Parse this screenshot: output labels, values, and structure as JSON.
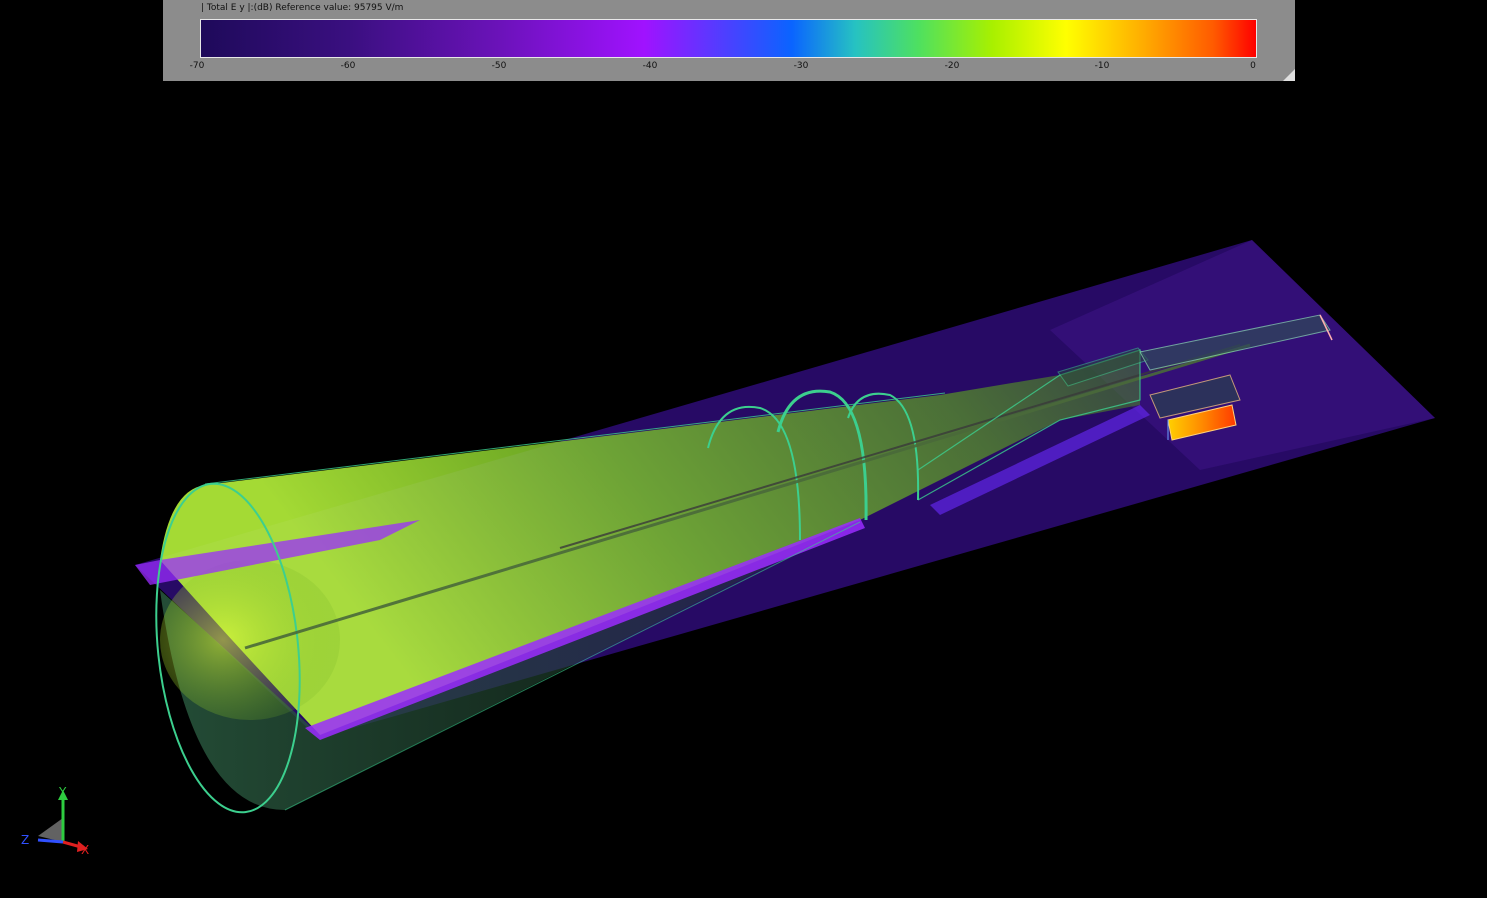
{
  "legend": {
    "title": "| Total E y |:(dB) Reference value: 95795 V/m",
    "ticks": [
      "-70",
      "-60",
      "-50",
      "-40",
      "-30",
      "-20",
      "-10",
      "0"
    ]
  },
  "colors": {
    "background": "#000000",
    "panel": "#8c8c8c",
    "outline": "#3ccf8e",
    "low": "#1e0a5a",
    "high": "#ff0000"
  },
  "axes": {
    "x": "X",
    "y": "Y",
    "z": "Z"
  }
}
